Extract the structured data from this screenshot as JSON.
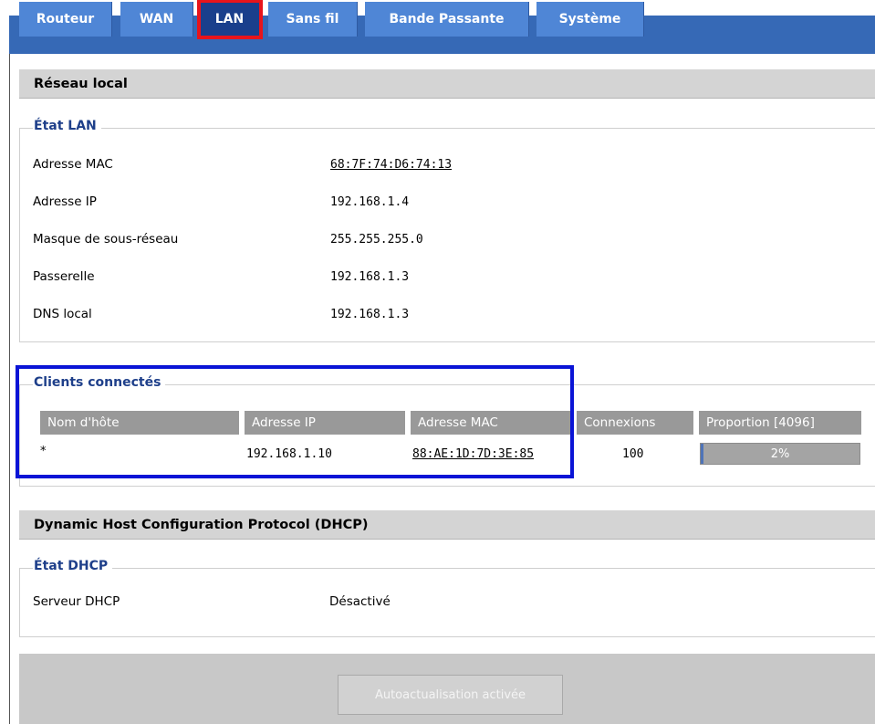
{
  "tabs": [
    {
      "label": "Routeur"
    },
    {
      "label": "WAN"
    },
    {
      "label": "LAN"
    },
    {
      "label": "Sans fil"
    },
    {
      "label": "Bande Passante"
    },
    {
      "label": "Système"
    }
  ],
  "active_tab": "LAN",
  "lan_section": {
    "title": "Réseau local",
    "status": {
      "legend": "État LAN",
      "rows": [
        {
          "label": "Adresse MAC",
          "value": "68:7F:74:D6:74:13"
        },
        {
          "label": "Adresse IP",
          "value": "192.168.1.4"
        },
        {
          "label": "Masque de sous-réseau",
          "value": "255.255.255.0"
        },
        {
          "label": "Passerelle",
          "value": "192.168.1.3"
        },
        {
          "label": "DNS local",
          "value": "192.168.1.3"
        }
      ]
    },
    "clients": {
      "legend": "Clients connectés",
      "headers": [
        "Nom d'hôte",
        "Adresse IP",
        "Adresse MAC",
        "Connexions",
        "Proportion [4096]"
      ],
      "rows": [
        {
          "hostname": "*",
          "ip": "192.168.1.10",
          "mac": "88:AE:1D:7D:3E:85",
          "connections": "100",
          "proportion": "2%",
          "proportion_value": 0.02
        }
      ]
    }
  },
  "dhcp_section": {
    "title": "Dynamic Host Configuration Protocol (DHCP)",
    "status": {
      "legend": "État DHCP",
      "rows": [
        {
          "label": "Serveur DHCP",
          "value": "Désactivé"
        }
      ]
    }
  },
  "footer": {
    "button_label": "Autoactualisation activée"
  },
  "colors": {
    "tab_bg": "#4f86d6",
    "tab_active_bg": "#1a3f8c",
    "highlight_red": "#e8141b",
    "highlight_blue": "#0a14d6",
    "legend_text": "#1e3f8a",
    "progress_fill": "#4f74b8"
  }
}
